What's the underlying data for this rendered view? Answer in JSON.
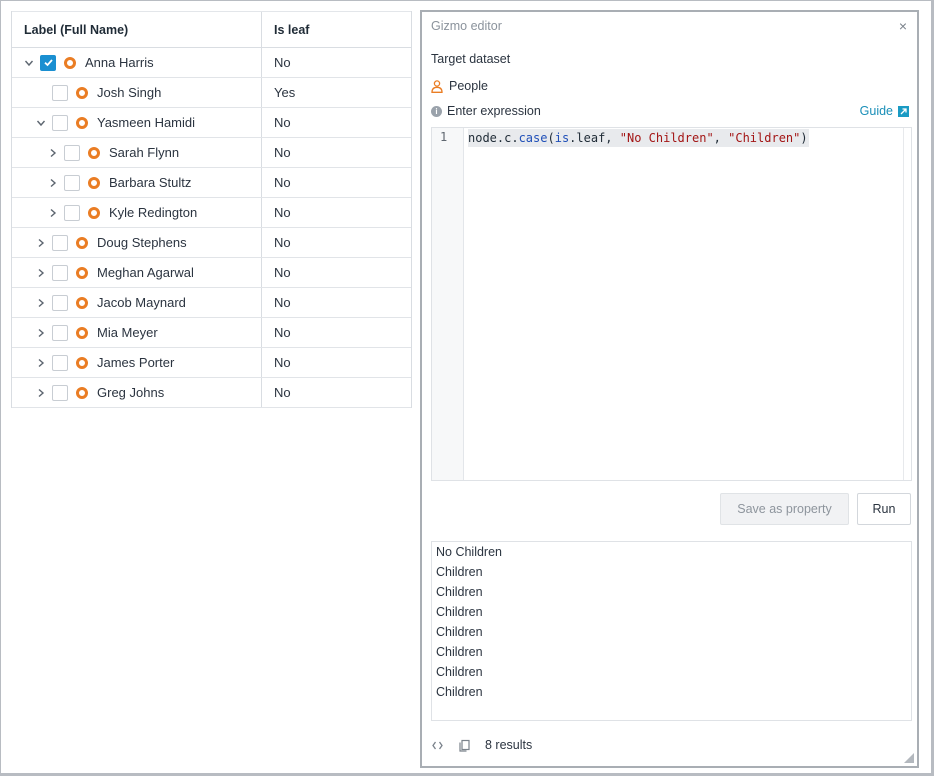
{
  "grid": {
    "columns": [
      "Label (Full Name)",
      "Is leaf"
    ],
    "rows": [
      {
        "name": "Anna Harris",
        "leaf": "No",
        "depth": 0,
        "expanded": true,
        "checked": true,
        "has_children": true
      },
      {
        "name": "Josh Singh",
        "leaf": "Yes",
        "depth": 1,
        "expanded": false,
        "checked": false,
        "has_children": false
      },
      {
        "name": "Yasmeen Hamidi",
        "leaf": "No",
        "depth": 1,
        "expanded": true,
        "checked": false,
        "has_children": true
      },
      {
        "name": "Sarah Flynn",
        "leaf": "No",
        "depth": 2,
        "expanded": false,
        "checked": false,
        "has_children": true
      },
      {
        "name": "Barbara Stultz",
        "leaf": "No",
        "depth": 2,
        "expanded": false,
        "checked": false,
        "has_children": true
      },
      {
        "name": "Kyle Redington",
        "leaf": "No",
        "depth": 2,
        "expanded": false,
        "checked": false,
        "has_children": true
      },
      {
        "name": "Doug Stephens",
        "leaf": "No",
        "depth": 1,
        "expanded": false,
        "checked": false,
        "has_children": true
      },
      {
        "name": "Meghan Agarwal",
        "leaf": "No",
        "depth": 1,
        "expanded": false,
        "checked": false,
        "has_children": true
      },
      {
        "name": "Jacob Maynard",
        "leaf": "No",
        "depth": 1,
        "expanded": false,
        "checked": false,
        "has_children": true
      },
      {
        "name": "Mia Meyer",
        "leaf": "No",
        "depth": 1,
        "expanded": false,
        "checked": false,
        "has_children": true
      },
      {
        "name": "James Porter",
        "leaf": "No",
        "depth": 1,
        "expanded": false,
        "checked": false,
        "has_children": true
      },
      {
        "name": "Greg Johns",
        "leaf": "No",
        "depth": 1,
        "expanded": false,
        "checked": false,
        "has_children": true
      }
    ]
  },
  "editor": {
    "title": "Gizmo editor",
    "close_icon": "×",
    "target_label": "Target dataset",
    "dataset_name": "People",
    "expression_label": "Enter expression",
    "guide_label": "Guide",
    "line_number": "1",
    "code": {
      "prefix": "node.c.",
      "fn": "case",
      "open": "(",
      "kw": "is",
      "mid": ".leaf, ",
      "str1": "\"No Children\"",
      "sep": ", ",
      "str2": "\"Children\"",
      "close": ")"
    },
    "save_button": "Save as property",
    "run_button": "Run",
    "results": [
      "No Children",
      "Children",
      "Children",
      "Children",
      "Children",
      "Children",
      "Children",
      "Children"
    ],
    "results_count": "8 results"
  },
  "colors": {
    "accent": "#1a8fd1",
    "node_ring": "#ea7d24",
    "link": "#1a8fb8"
  }
}
